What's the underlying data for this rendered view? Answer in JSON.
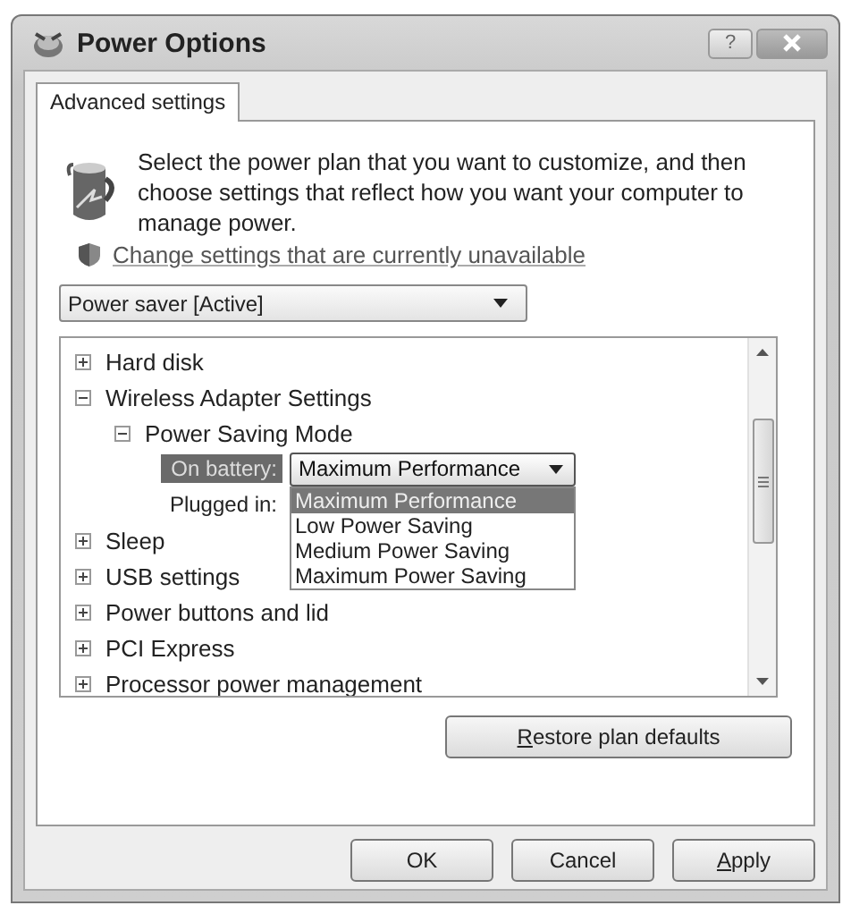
{
  "window": {
    "title": "Power Options",
    "help_button": "?"
  },
  "tabs": [
    {
      "label": "Advanced settings",
      "selected": true
    }
  ],
  "intro": "Select the power plan that you want to customize, and then choose settings that reflect how you want your computer to manage power.",
  "unavailable_link": "Change settings that are currently unavailable",
  "plan_select": {
    "value": "Power saver [Active]"
  },
  "tree": {
    "items": [
      {
        "label": "Hard disk",
        "expanded": false
      },
      {
        "label": "Wireless Adapter Settings",
        "expanded": true,
        "children": [
          {
            "label": "Power Saving Mode",
            "expanded": true,
            "settings": [
              {
                "label": "On battery:",
                "selected": true,
                "value": "Maximum Performance",
                "options": [
                  {
                    "label": "Maximum Performance",
                    "selected": true
                  },
                  {
                    "label": "Low Power Saving",
                    "selected": false
                  },
                  {
                    "label": "Medium Power Saving",
                    "selected": false
                  },
                  {
                    "label": "Maximum Power Saving",
                    "selected": false
                  }
                ]
              },
              {
                "label": "Plugged in:",
                "selected": false
              }
            ]
          }
        ]
      },
      {
        "label": "Sleep",
        "expanded": false
      },
      {
        "label": "USB settings",
        "expanded": false
      },
      {
        "label": "Power buttons and lid",
        "expanded": false
      },
      {
        "label": "PCI Express",
        "expanded": false
      },
      {
        "label": "Processor power management",
        "expanded": false
      }
    ]
  },
  "restore_button": {
    "label": "Restore plan defaults",
    "underline_first": true
  },
  "buttons": [
    {
      "label": "OK",
      "underline_first": false
    },
    {
      "label": "Cancel",
      "underline_first": false
    },
    {
      "label": "Apply",
      "underline_first": true
    }
  ]
}
